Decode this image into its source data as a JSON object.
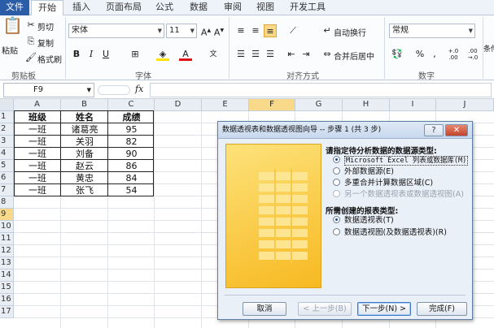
{
  "ribbon_tabs": [
    "文件",
    "开始",
    "插入",
    "页面布局",
    "公式",
    "数据",
    "审阅",
    "视图",
    "开发工具"
  ],
  "clipboard": {
    "paste": "粘贴",
    "cut": "剪切",
    "copy": "复制",
    "format_painter": "格式刷",
    "label": "剪贴板"
  },
  "font": {
    "name": "宋体",
    "size": "11",
    "bold": "B",
    "italic": "I",
    "underline": "U",
    "label": "字体"
  },
  "alignment": {
    "wrap_text": "自动换行",
    "merge_center": "合并后居中",
    "label": "对齐方式"
  },
  "number": {
    "format": "常规",
    "percent": "%",
    "comma": ",",
    "inc_decimal": "+.0 .00",
    "dec_decimal": ".00 →.0",
    "label": "数字"
  },
  "styles": {
    "conditional": "条件"
  },
  "formula_bar": {
    "name_box": "F9",
    "fx": "fx"
  },
  "columns": [
    "A",
    "B",
    "C",
    "D",
    "E",
    "F",
    "G",
    "H",
    "I",
    "J"
  ],
  "rows": [
    "1",
    "2",
    "3",
    "4",
    "5",
    "6",
    "7",
    "8",
    "9",
    "10",
    "11",
    "12",
    "13",
    "14",
    "15",
    "16",
    "17"
  ],
  "selected_cell": "F9",
  "table": {
    "headers": [
      "班级",
      "姓名",
      "成绩"
    ],
    "rows": [
      [
        "一班",
        "诸葛亮",
        "95"
      ],
      [
        "一班",
        "关羽",
        "82"
      ],
      [
        "一班",
        "刘备",
        "90"
      ],
      [
        "一班",
        "赵云",
        "86"
      ],
      [
        "一班",
        "黄忠",
        "84"
      ],
      [
        "一班",
        "张飞",
        "54"
      ]
    ]
  },
  "dialog": {
    "title": "数据透视表和数据透视图向导 -- 步骤 1 (共 3 步)",
    "help": "?",
    "close": "✕",
    "q1": "请指定待分析数据的数据源类型:",
    "source_options": [
      {
        "label": "Microsoft Excel 列表或数据库(M)",
        "selected": true,
        "enabled": true
      },
      {
        "label": "外部数据源(E)",
        "selected": false,
        "enabled": true
      },
      {
        "label": "多重合并计算数据区域(C)",
        "selected": false,
        "enabled": true
      },
      {
        "label": "另一个数据透视表或数据透视图(A)",
        "selected": false,
        "enabled": false
      }
    ],
    "q2": "所需创建的报表类型:",
    "report_options": [
      {
        "label": "数据透视表(T)",
        "selected": true,
        "enabled": true
      },
      {
        "label": "数据透视图(及数据透视表)(R)",
        "selected": false,
        "enabled": true
      }
    ],
    "buttons": {
      "cancel": "取消",
      "back": "< 上一步(B)",
      "next": "下一步(N) >",
      "finish": "完成(F)"
    }
  },
  "colors": {
    "accent": "#2a5ca8",
    "selection": "#f8d98a",
    "illustration": "#f7b921"
  }
}
